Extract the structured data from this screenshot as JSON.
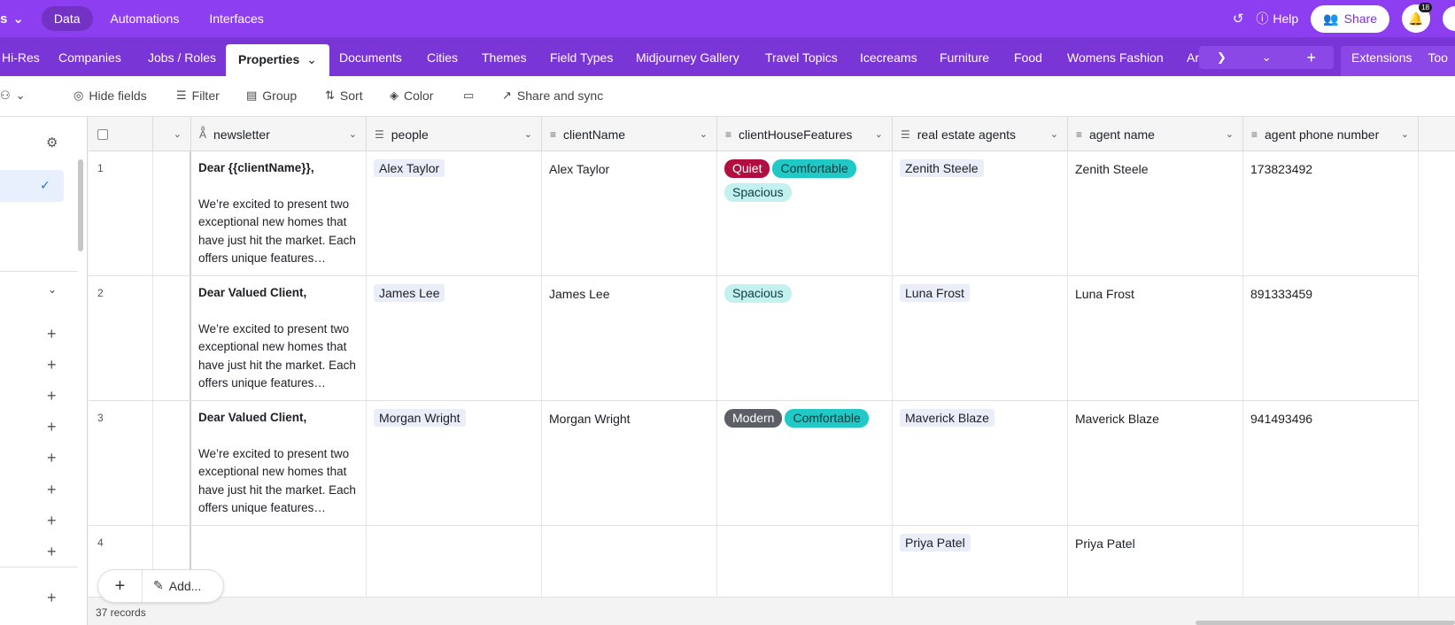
{
  "topbar": {
    "logo_fragment": "s",
    "nav": [
      {
        "label": "Data",
        "active": true
      },
      {
        "label": "Automations",
        "active": false
      },
      {
        "label": "Interfaces",
        "active": false
      }
    ],
    "help_label": "Help",
    "share_label": "Share",
    "notif_count": "18"
  },
  "tabs": {
    "items": [
      "Hi-Res",
      "Companies",
      "Jobs / Roles",
      "Properties",
      "Documents",
      "Cities",
      "Themes",
      "Field Types",
      "Midjourney Gallery",
      "Travel Topics",
      "Icecreams",
      "Furniture",
      "Food",
      "Womens Fashion",
      "Ar"
    ],
    "active": "Properties",
    "extensions_label": "Extensions",
    "tools_label": "Too"
  },
  "toolbar": {
    "hide_fields": "Hide fields",
    "filter": "Filter",
    "group": "Group",
    "sort": "Sort",
    "color": "Color",
    "share_sync": "Share and sync"
  },
  "grid": {
    "columns": [
      "newsletter",
      "people",
      "clientName",
      "clientHouseFeatures",
      "real estate agents",
      "agent name",
      "agent phone number"
    ],
    "rows": [
      {
        "num": "1",
        "greeting": "Dear {{clientName}},",
        "body": "We’re excited to present two exceptional new homes that have just hit the market. Each offers unique features…",
        "people": "Alex Taylor",
        "clientName": "Alex Taylor",
        "features": [
          "Quiet",
          "Comfortable",
          "Spacious"
        ],
        "agent": "Zenith Steele",
        "agentName": "Zenith Steele",
        "phone": "173823492"
      },
      {
        "num": "2",
        "greeting": "Dear Valued Client,",
        "body": "We’re excited to present two exceptional new homes that have just hit the market. Each offers unique features…",
        "people": "James Lee",
        "clientName": "James Lee",
        "features": [
          "Spacious"
        ],
        "agent": "Luna Frost",
        "agentName": "Luna Frost",
        "phone": "891333459"
      },
      {
        "num": "3",
        "greeting": "Dear Valued Client,",
        "body": "We’re excited to present two exceptional new homes that have just hit the market. Each offers unique features…",
        "people": "Morgan Wright",
        "clientName": "Morgan Wright",
        "features": [
          "Modern",
          "Comfortable"
        ],
        "agent": "Maverick Blaze",
        "agentName": "Maverick Blaze",
        "phone": "941493496"
      },
      {
        "num": "4",
        "greeting": "",
        "body": "",
        "people": "",
        "clientName": "",
        "features": [],
        "agent": "Priya Patel",
        "agentName": "Priya Patel",
        "phone": ""
      }
    ]
  },
  "footer": {
    "records": "37 records",
    "add_label": "Add..."
  },
  "colors": {
    "topbar": "#8c3ef0",
    "tabsbar": "#7a35d6",
    "quiet": "#b10f41",
    "comfortable": "#20c9c6",
    "spacious": "#c3f1ef",
    "modern": "#5c6066"
  }
}
